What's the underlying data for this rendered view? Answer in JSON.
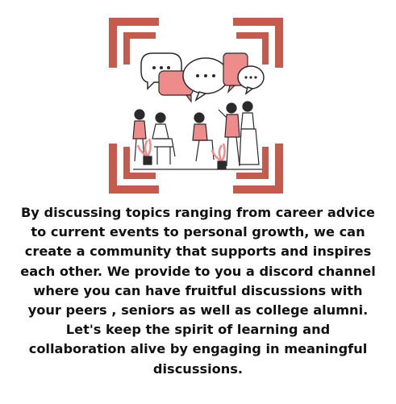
{
  "colors": {
    "frame": "#c65b4c",
    "accent": "#ee8c8c",
    "ink": "#2a2a2a",
    "text": "#111111",
    "background": "#ffffff"
  },
  "illustration": {
    "icon": "people-discussion-illustration",
    "frame_icon": "corner-frame"
  },
  "caption": {
    "lines": [
      "By discussing topics ranging from career advice",
      "to current events to personal growth, we can",
      "create a community that supports and inspires",
      "each other. We provide to you a discord channel",
      "where you can have fruitful discussions with",
      "your peers , seniors as well as college alumni.",
      "Let's keep the spirit of learning and",
      "collaboration alive by engaging in meaningful",
      "discussions."
    ]
  }
}
